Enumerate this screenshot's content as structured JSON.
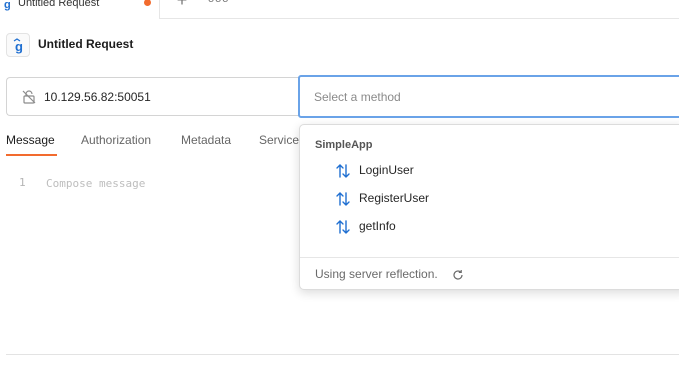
{
  "tab": {
    "title": "Untitled Request",
    "icon": "grpc-icon",
    "unsaved_indicator_color": "#f26b2e"
  },
  "tabstrip": {
    "add_label": "+",
    "more_label": "ooo"
  },
  "request": {
    "icon_glyph": "g",
    "title": "Untitled Request"
  },
  "url": {
    "value": "10.129.56.82:50051"
  },
  "method": {
    "placeholder": "Select a method"
  },
  "subtabs": [
    {
      "label": "Message",
      "active": true
    },
    {
      "label": "Authorization",
      "active": false
    },
    {
      "label": "Metadata",
      "active": false
    },
    {
      "label": "Service",
      "active": false
    }
  ],
  "editor": {
    "line_number": "1",
    "placeholder": "Compose message"
  },
  "dropdown": {
    "group_label": "SimpleApp",
    "items": [
      {
        "label": "LoginUser",
        "icon": "bidirectional-stream-icon"
      },
      {
        "label": "RegisterUser",
        "icon": "bidirectional-stream-icon"
      },
      {
        "label": "getInfo",
        "icon": "bidirectional-stream-icon"
      }
    ],
    "footer": "Using server reflection."
  },
  "colors": {
    "accent": "#f26b2e",
    "focus": "#6aa3e8",
    "icon_blue": "#1f6fd1"
  }
}
